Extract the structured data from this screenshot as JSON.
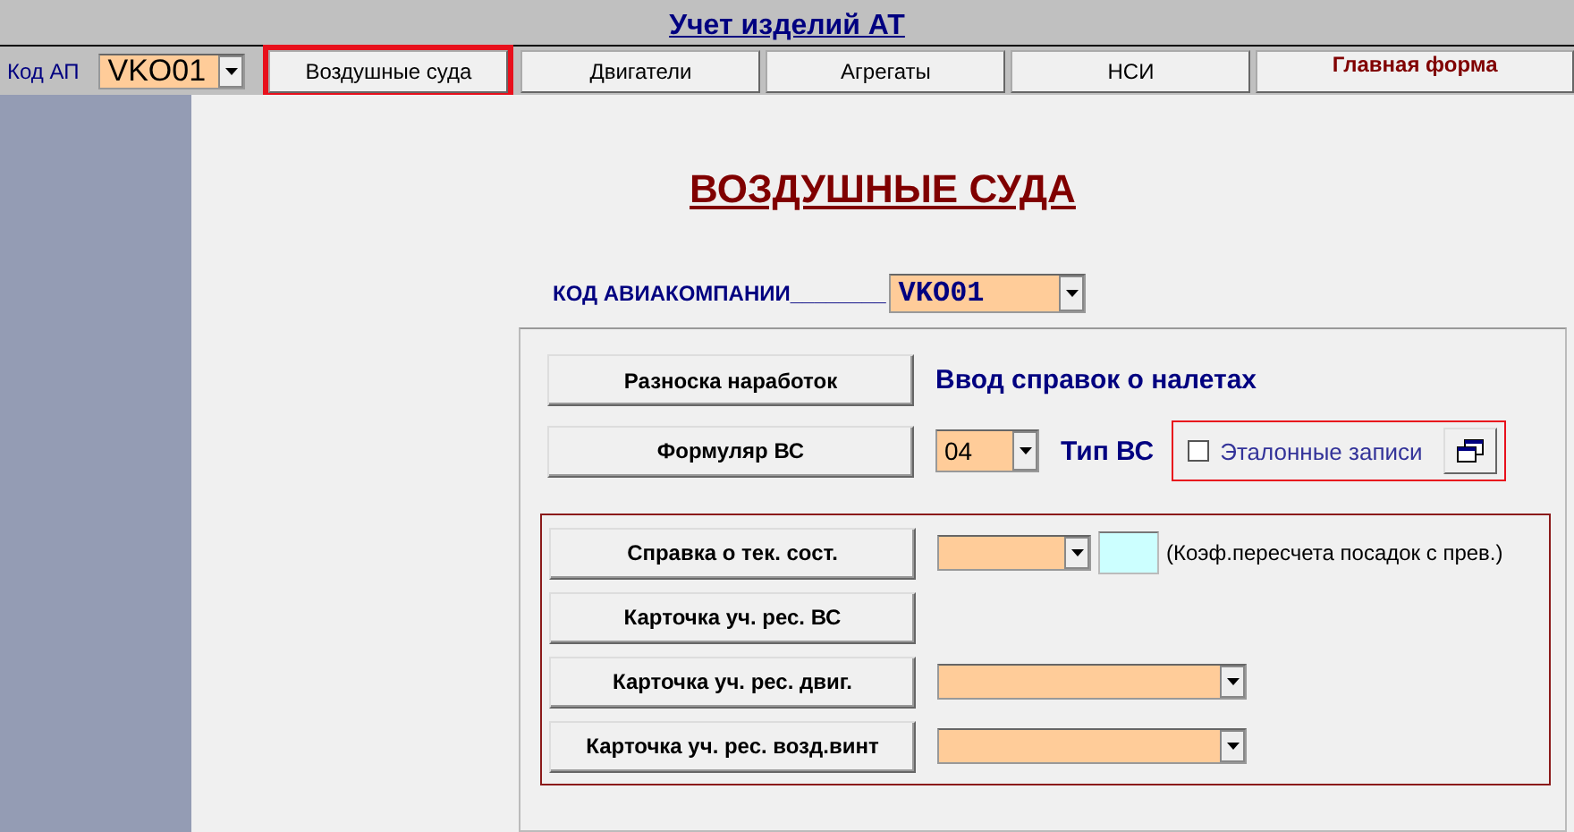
{
  "window": {
    "title": "Учет изделий АТ"
  },
  "airline_selector": {
    "label": "Код АП",
    "value": "VKO01"
  },
  "tabs": [
    {
      "label": "Воздушные суда",
      "selected": true,
      "kind": "normal"
    },
    {
      "label": "Двигатели",
      "selected": false,
      "kind": "normal"
    },
    {
      "label": "Агрегаты",
      "selected": false,
      "kind": "normal"
    },
    {
      "label": "НСИ",
      "selected": false,
      "kind": "normal"
    },
    {
      "label": "Главная форма",
      "selected": false,
      "kind": "main"
    }
  ],
  "heading": "ВОЗДУШНЫЕ СУДА",
  "airline_code": {
    "label": "КОД АВИАКОМПАНИИ________",
    "value": "VKO01"
  },
  "flight_section": {
    "buttons": [
      "Разноска наработок",
      "Формуляр ВС"
    ],
    "caption": "Ввод справок о налетах",
    "type_value": "04",
    "type_label": "Тип ВС",
    "reference_records": {
      "label": "Эталонные записи",
      "checked": false
    }
  },
  "reports": [
    {
      "button": "Справка о тек. сост.",
      "kind": "combo_coef",
      "coef_label": "(Коэф.пересчета посадок с прев.)"
    },
    {
      "button": "Карточка уч. рес. ВС",
      "kind": "plain"
    },
    {
      "button": "Карточка уч. рес. двиг.",
      "kind": "combo"
    },
    {
      "button": "Карточка уч. рес. возд.винт",
      "kind": "combo"
    }
  ]
}
